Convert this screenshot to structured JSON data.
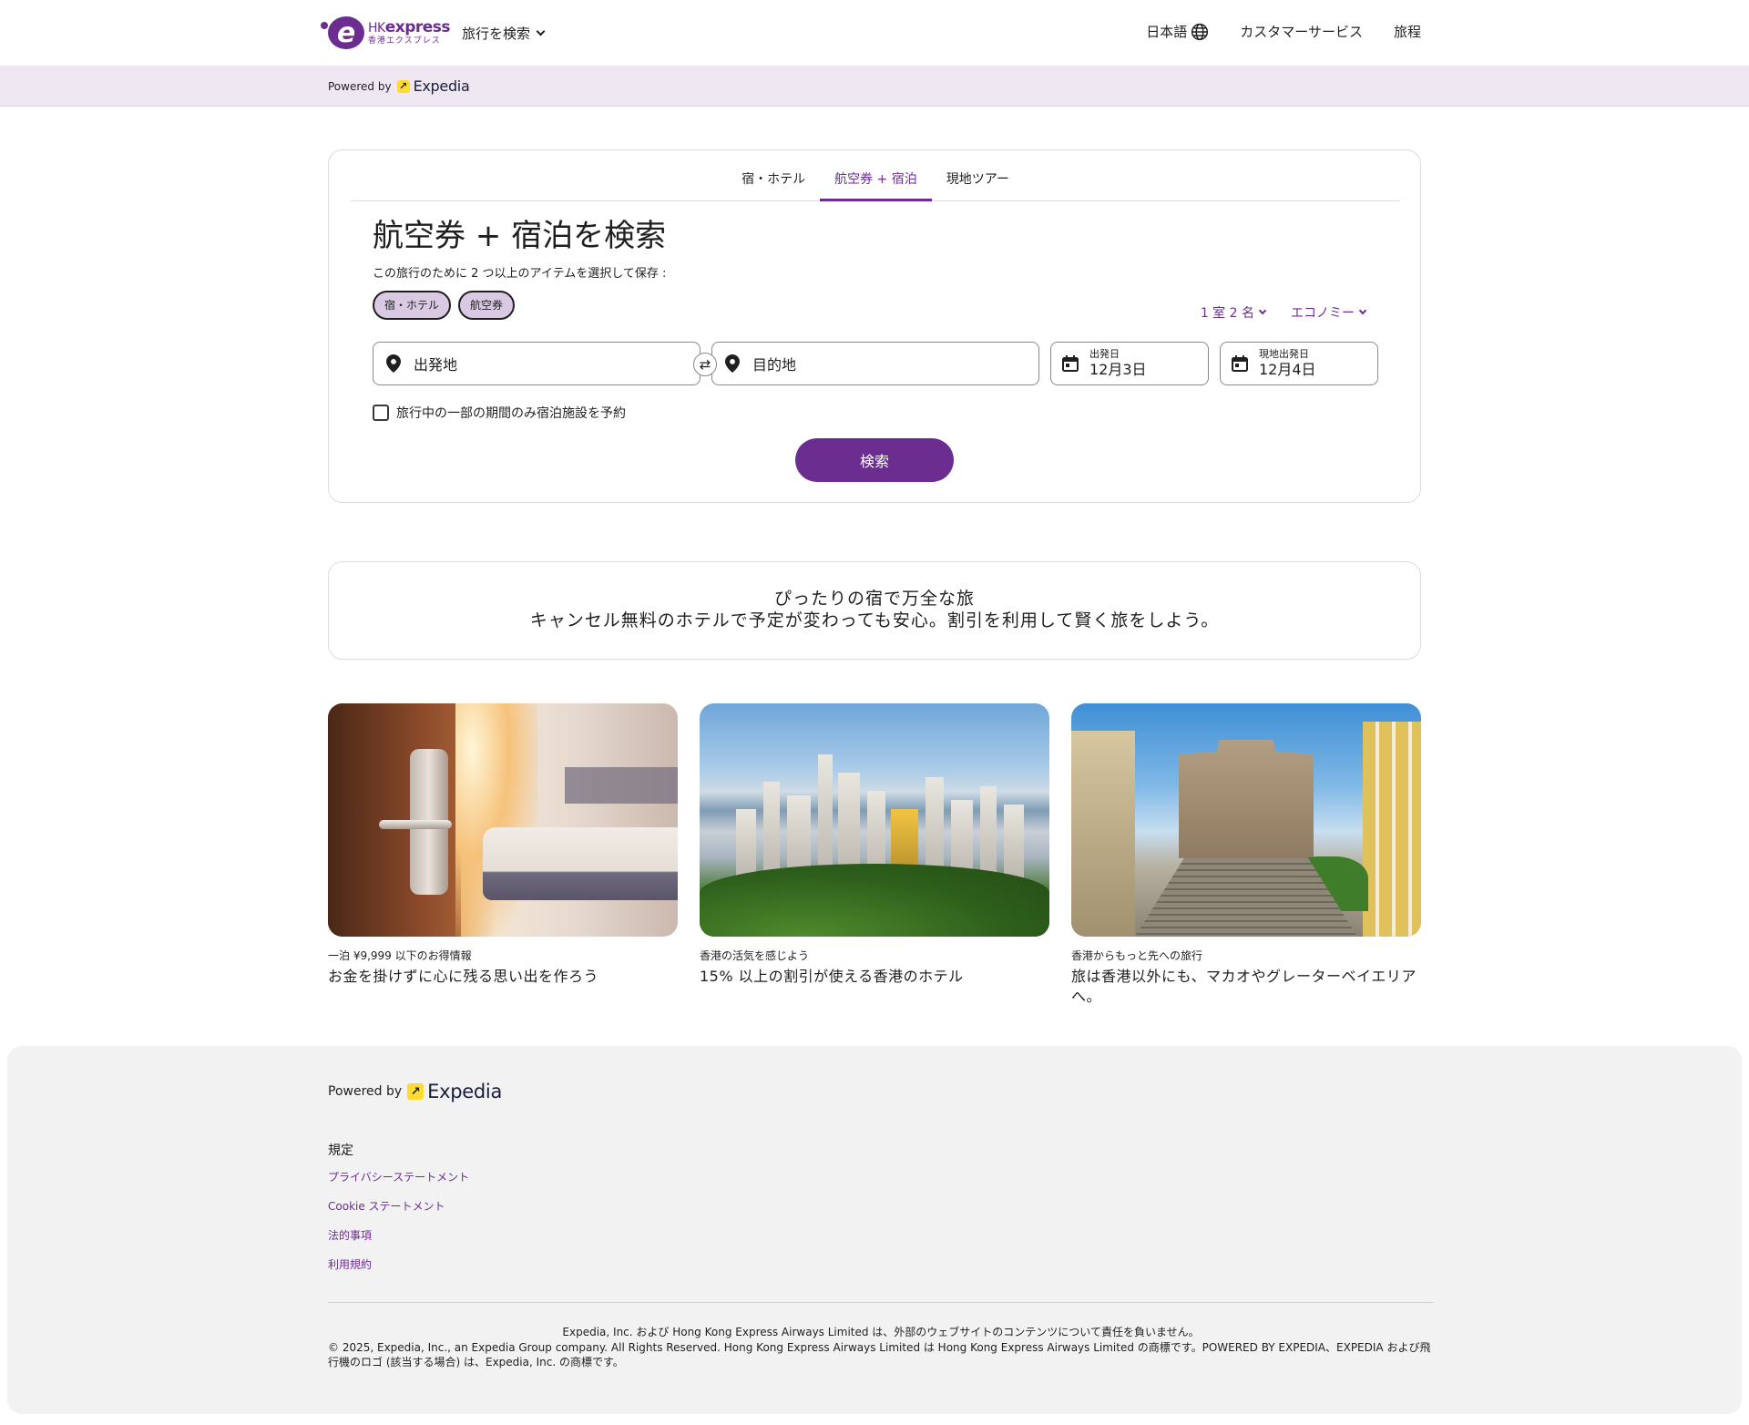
{
  "header": {
    "logo_brand": "HK",
    "logo_brand_bold": "express",
    "logo_sub": "香港エクスプレス",
    "nav_search": "旅行を検索",
    "language": "日本語",
    "customer_service": "カスタマーサービス",
    "itinerary": "旅程"
  },
  "powered_bar": {
    "powered_by": "Powered by",
    "expedia": "Expedia"
  },
  "search": {
    "tabs": [
      {
        "label": "宿・ホテル",
        "active": false
      },
      {
        "label": "航空券 + 宿泊",
        "active": true
      },
      {
        "label": "現地ツアー",
        "active": false
      }
    ],
    "title": "航空券 + 宿泊を検索",
    "subtitle": "この旅行のために 2 つ以上のアイテムを選択して保存 :",
    "chips": [
      "宿・ホテル",
      "航空券"
    ],
    "rooms_travelers": "1 室 2 名",
    "cabin_class": "エコノミー",
    "origin_placeholder": "出発地",
    "destination_placeholder": "目的地",
    "depart_label": "出発日",
    "depart_value": "12月3日",
    "return_label": "現地出発日",
    "return_value": "12月4日",
    "partial_stay_label": "旅行中の一部の期間のみ宿泊施設を予約",
    "search_button": "検索"
  },
  "promo": {
    "line1": "ぴったりの宿で万全な旅",
    "line2": "キャンセル無料のホテルで予定が変わっても安心。割引を利用して賢く旅をしよう。"
  },
  "cards": [
    {
      "small": "一泊 ¥9,999 以下のお得情報",
      "big": "お金を掛けずに心に残る思い出を作ろう"
    },
    {
      "small": "香港の活気を感じよう",
      "big": "15% 以上の割引が使える香港のホテル"
    },
    {
      "small": "香港からもっと先への旅行",
      "big": "旅は香港以外にも、マカオやグレーターベイエリアへ。"
    }
  ],
  "footer": {
    "powered_by": "Powered by",
    "expedia": "Expedia",
    "heading": "規定",
    "links": [
      "プライバシーステートメント",
      "Cookie ステートメント",
      "法的事項",
      "利用規約"
    ],
    "legal1": "Expedia, Inc. および Hong Kong Express Airways Limited は、外部のウェブサイトのコンテンツについて責任を負いません。",
    "legal2": "© 2025, Expedia, Inc., an Expedia Group company. All Rights Reserved. Hong Kong Express Airways Limited は Hong Kong Express Airways Limited の商標です。POWERED BY EXPEDIA、EXPEDIA および飛行機のロゴ (該当する場合) は、Expedia, Inc. の商標です。"
  },
  "colors": {
    "brand_purple": "#6c2d91",
    "powered_bar_bg": "#efe8f2",
    "chip_bg": "#d9c9e3",
    "footer_bg": "#f2f2f2",
    "expedia_yellow": "#fddb32"
  }
}
